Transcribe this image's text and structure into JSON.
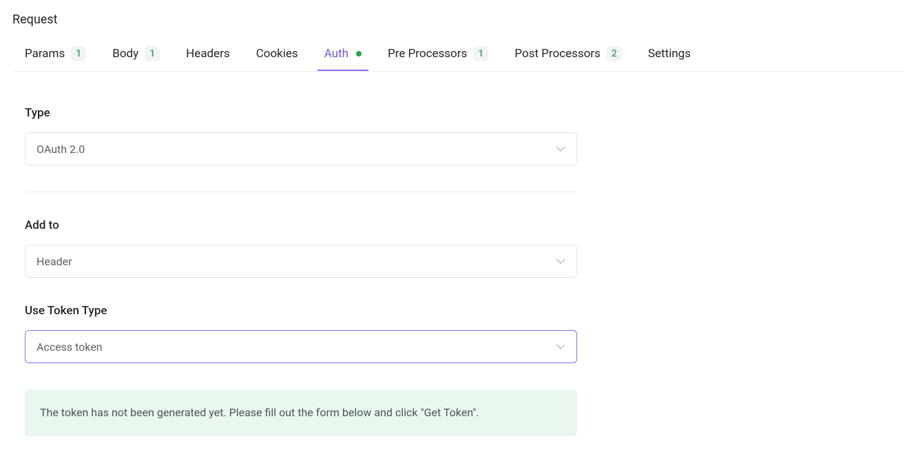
{
  "page": {
    "title": "Request"
  },
  "tabs": {
    "params": {
      "label": "Params",
      "count": "1"
    },
    "body": {
      "label": "Body",
      "count": "1"
    },
    "headers": {
      "label": "Headers"
    },
    "cookies": {
      "label": "Cookies"
    },
    "auth": {
      "label": "Auth"
    },
    "pre_processors": {
      "label": "Pre Processors",
      "count": "1"
    },
    "post_processors": {
      "label": "Post Processors",
      "count": "2"
    },
    "settings": {
      "label": "Settings"
    }
  },
  "auth": {
    "type_label": "Type",
    "type_value": "OAuth 2.0",
    "add_to_label": "Add to",
    "add_to_value": "Header",
    "use_token_type_label": "Use Token Type",
    "use_token_type_value": "Access token",
    "info_message": "The token has not been generated yet. Please fill out the form below and click \"Get Token\"."
  }
}
